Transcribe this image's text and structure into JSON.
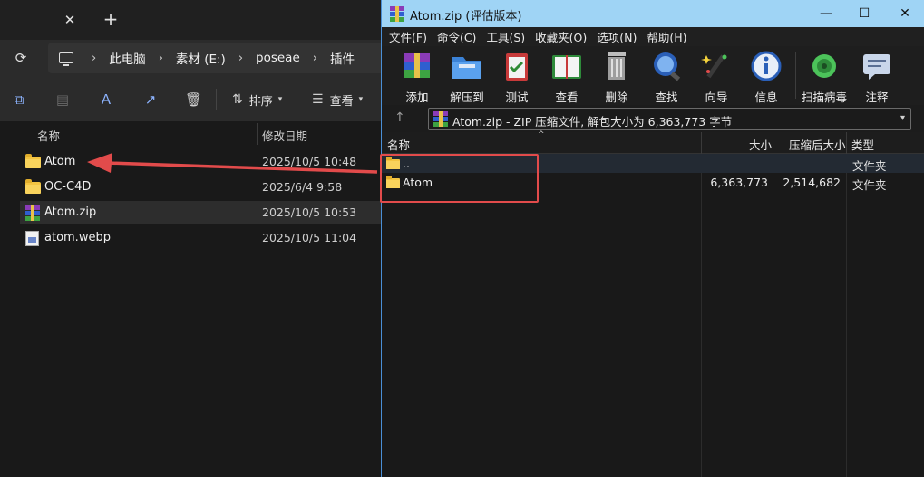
{
  "explorer": {
    "addressbar": {
      "breadcrumbs": [
        "此电脑",
        "素材 (E:)",
        "poseae",
        "插件"
      ]
    },
    "toolbar": {
      "sort_label": "排序",
      "view_label": "查看"
    },
    "columns": {
      "name": "名称",
      "date": "修改日期"
    },
    "files": [
      {
        "name": "Atom",
        "date": "2025/10/5 10:48",
        "kind": "folder"
      },
      {
        "name": "OC-C4D",
        "date": "2025/6/4 9:58",
        "kind": "folder"
      },
      {
        "name": "Atom.zip",
        "date": "2025/10/5 10:53",
        "kind": "archive"
      },
      {
        "name": "atom.webp",
        "date": "2025/10/5 11:04",
        "kind": "image"
      }
    ]
  },
  "winrar": {
    "title": "Atom.zip (评估版本)",
    "menu": [
      "文件(F)",
      "命令(C)",
      "工具(S)",
      "收藏夹(O)",
      "选项(N)",
      "帮助(H)"
    ],
    "tools": [
      "添加",
      "解压到",
      "测试",
      "查看",
      "删除",
      "查找",
      "向导",
      "信息",
      "扫描病毒",
      "注释"
    ],
    "address": "Atom.zip - ZIP 压缩文件, 解包大小为 6,363,773 字节",
    "columns": {
      "name": "名称",
      "size": "大小",
      "packed": "压缩后大小",
      "type": "类型"
    },
    "rows": [
      {
        "name": "..",
        "size": "",
        "packed": "",
        "type": "文件夹"
      },
      {
        "name": "Atom",
        "size": "6,363,773",
        "packed": "2,514,682",
        "type": "文件夹"
      }
    ]
  },
  "colors": {
    "annotation_red": "#e24b4b",
    "title_bar": "#9fd4f5",
    "folder_yellow": "#f4c542"
  }
}
